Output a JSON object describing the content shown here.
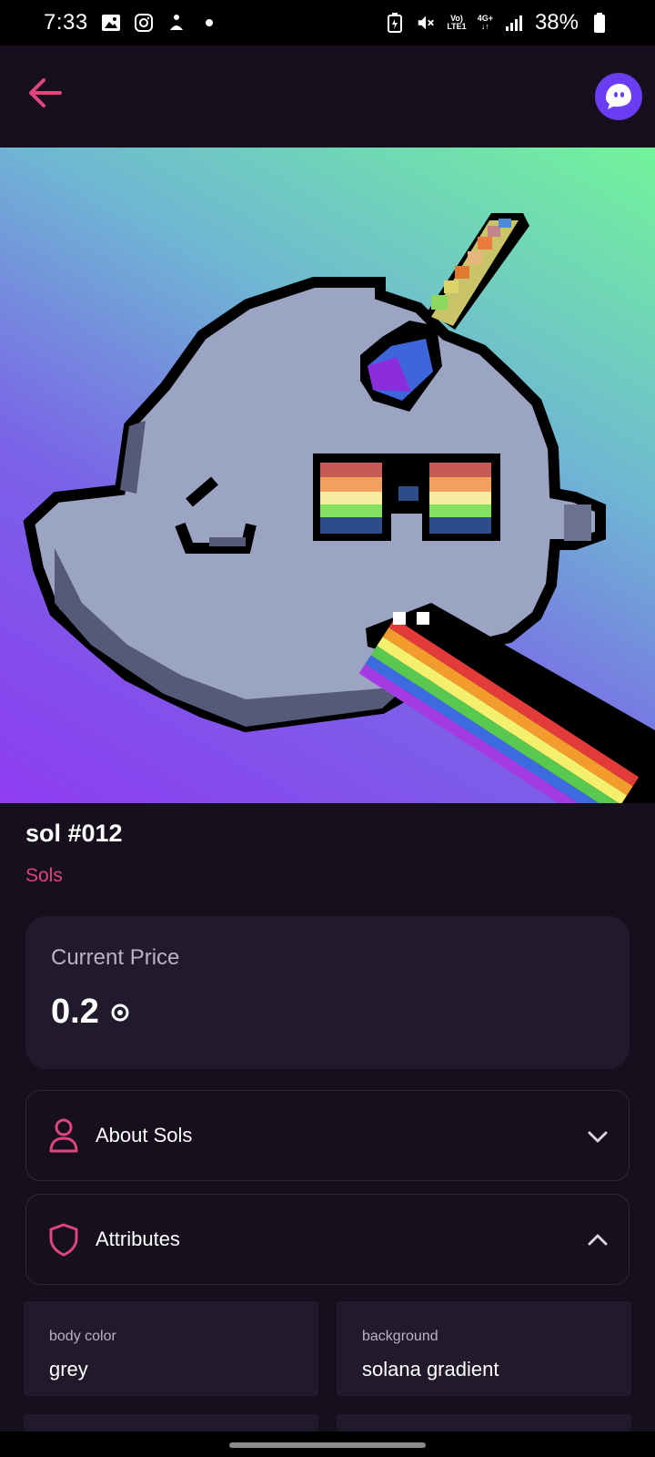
{
  "status_bar": {
    "time": "7:33",
    "network_top": "Vo)",
    "network_bottom": "LTE1",
    "data_top": "4G+",
    "data_bottom": "↓↑",
    "battery": "38%"
  },
  "header": {
    "back_icon": "arrow-left-icon",
    "avatar_icon": "ghost-icon"
  },
  "nft": {
    "title": "sol #012",
    "collection": "Sols"
  },
  "price": {
    "label": "Current Price",
    "value": "0.2",
    "currency_icon": "sol-coin-icon"
  },
  "sections": {
    "about_label": "About Sols",
    "attributes_label": "Attributes"
  },
  "attributes": [
    {
      "key": "body color",
      "value": "grey"
    },
    {
      "key": "background",
      "value": "solana gradient"
    }
  ],
  "colors": {
    "accent": "#e0457b",
    "background": "#150f1e",
    "card": "#211a2c"
  }
}
